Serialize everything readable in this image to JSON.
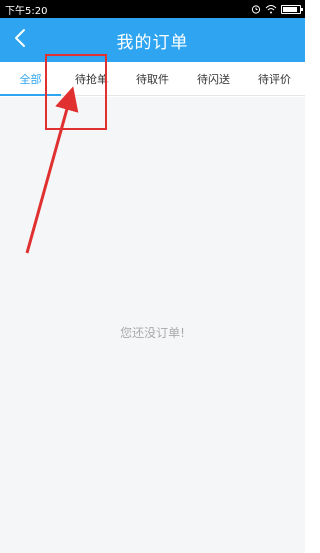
{
  "statusbar": {
    "time": "下午5:20",
    "icons": [
      "alarm-icon",
      "wifi-icon",
      "battery-icon"
    ],
    "battery_level": 0.85
  },
  "header": {
    "title": "我的订单",
    "back_icon": "chevron-left-icon",
    "background": "#2fa5f2"
  },
  "tabs": [
    {
      "label": "全部",
      "active": true
    },
    {
      "label": "待抢单",
      "active": false
    },
    {
      "label": "待取件",
      "active": false
    },
    {
      "label": "待闪送",
      "active": false
    },
    {
      "label": "待评价",
      "active": false
    }
  ],
  "main": {
    "empty_message": "您还没订单!"
  },
  "annotation": {
    "color": "#e03030"
  },
  "colors": {
    "accent": "#2fa5f2",
    "annotation": "#e03030"
  }
}
